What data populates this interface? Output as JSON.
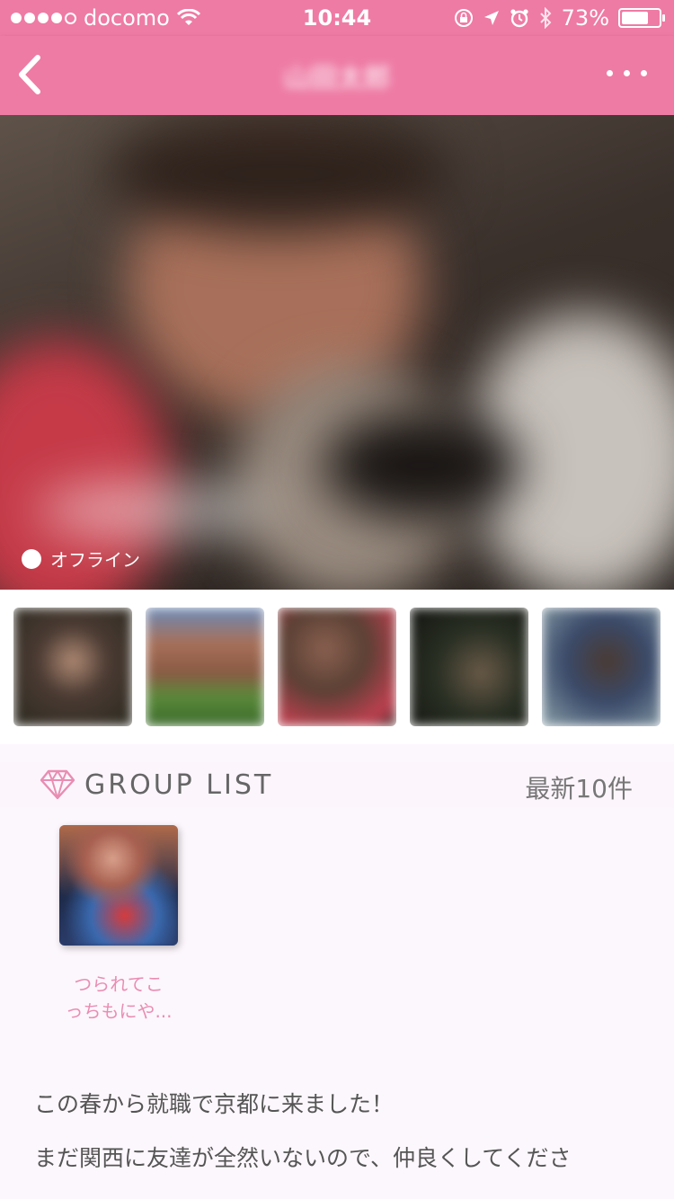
{
  "status_bar": {
    "carrier": "docomo",
    "time": "10:44",
    "battery": "73%",
    "battery_level": 0.73
  },
  "navbar": {
    "title": "山田太郎",
    "back_icon": "chevron-left-icon",
    "more_icon": "more-horizontal-icon"
  },
  "profile": {
    "online_status": "オフライン"
  },
  "group_section": {
    "title": "GROUP LIST",
    "count": "最新10件",
    "groups": [
      {
        "name_line1": "つられてこ",
        "name_line2": "っちもにや..."
      }
    ]
  },
  "bio": {
    "line1": "この春から就職で京都に来ました！",
    "line2": "まだ関西に友達が全然いないので、仲良くしてくださ"
  },
  "colors": {
    "accent": "#ee7ba4",
    "group_name": "#e98db3"
  }
}
